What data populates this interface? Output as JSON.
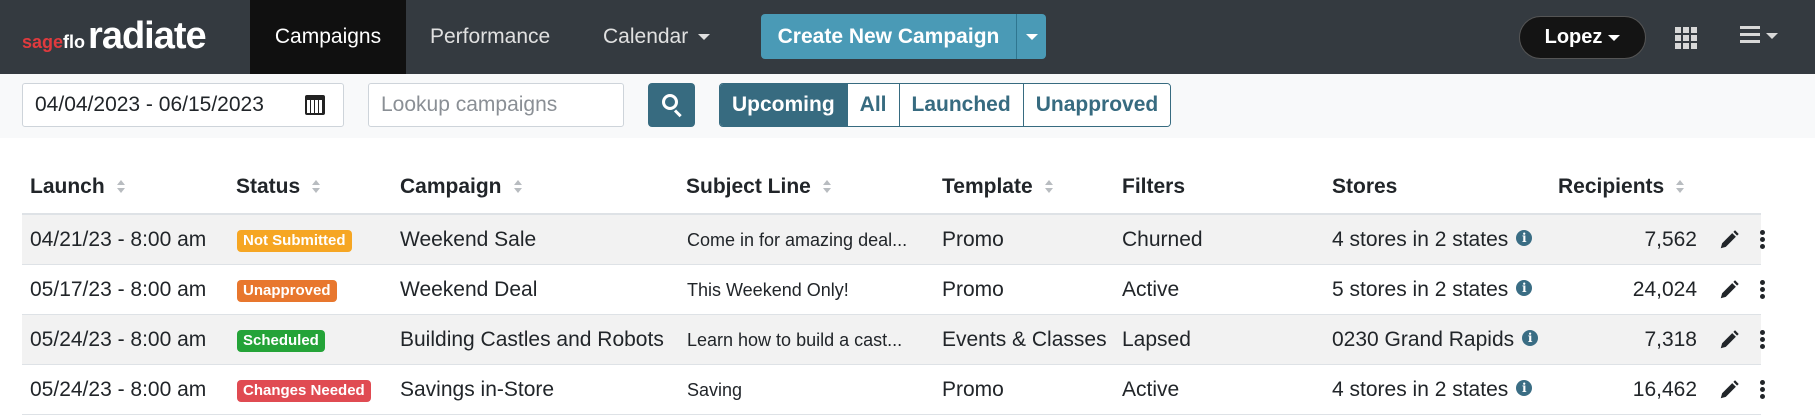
{
  "brand": {
    "small_prefix": "sage",
    "small_suffix": "flo",
    "big": "radiate"
  },
  "nav": {
    "items": [
      {
        "label": "Campaigns",
        "active": true
      },
      {
        "label": "Performance",
        "active": false
      },
      {
        "label": "Calendar",
        "active": false
      }
    ],
    "create_label": "Create New Campaign",
    "user_label": "Lopez"
  },
  "filters": {
    "date_range": "04/04/2023 - 06/15/2023",
    "search_placeholder": "Lookup campaigns",
    "segments": [
      {
        "label": "Upcoming",
        "active": true
      },
      {
        "label": "All",
        "active": false
      },
      {
        "label": "Launched",
        "active": false
      },
      {
        "label": "Unapproved",
        "active": false
      }
    ]
  },
  "table": {
    "headers": {
      "launch": "Launch",
      "status": "Status",
      "campaign": "Campaign",
      "subject": "Subject Line",
      "template": "Template",
      "filters": "Filters",
      "stores": "Stores",
      "recipients": "Recipients"
    },
    "rows": [
      {
        "launch": "04/21/23 - 8:00 am",
        "status": "Not Submitted",
        "status_color": "#f6a623",
        "campaign": "Weekend Sale",
        "subject": "Come in for amazing deal...",
        "template": "Promo",
        "filters": "Churned",
        "stores": "4 stores in 2 states",
        "recipients": "7,562"
      },
      {
        "launch": "05/17/23 - 8:00 am",
        "status": "Unapproved",
        "status_color": "#e8772e",
        "campaign": "Weekend Deal",
        "subject": "This Weekend Only!",
        "template": "Promo",
        "filters": "Active",
        "stores": "5 stores in 2 states",
        "recipients": "24,024"
      },
      {
        "launch": "05/24/23 - 8:00 am",
        "status": "Scheduled",
        "status_color": "#24a338",
        "campaign": "Building Castles and Robots",
        "subject": "Learn how to build a cast...",
        "template": "Events & Classes",
        "filters": "Lapsed",
        "stores": "0230 Grand Rapids",
        "recipients": "7,318"
      },
      {
        "launch": "05/24/23 - 8:00 am",
        "status": "Changes Needed",
        "status_color": "#e04b52",
        "campaign": "Savings in-Store",
        "subject": "Saving",
        "template": "Promo",
        "filters": "Active",
        "stores": "4 stores in 2 states",
        "recipients": "16,462"
      }
    ]
  },
  "colors": {
    "nav_bg": "#343a40",
    "accent": "#376b80",
    "create_btn": "#4a9ab6"
  },
  "icons": [
    "calendar-icon",
    "search-icon",
    "info-icon",
    "pencil-icon",
    "kebab-icon",
    "apps-grid-icon",
    "hamburger-menu-icon"
  ]
}
